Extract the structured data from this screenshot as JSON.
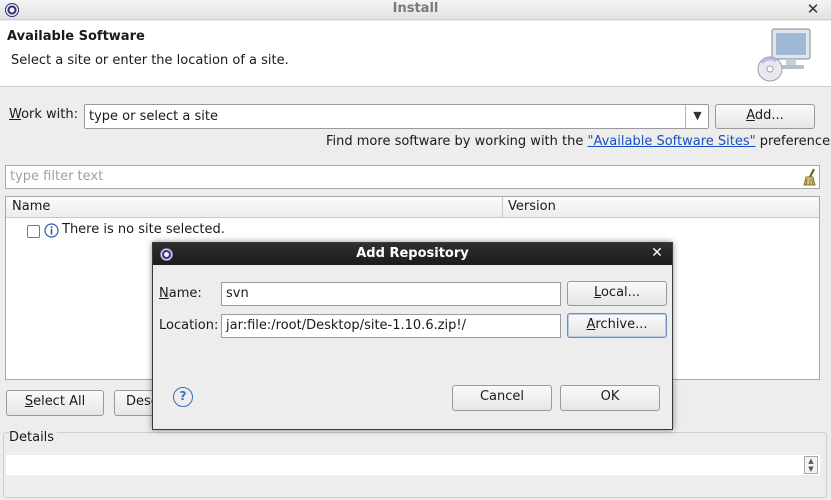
{
  "window": {
    "title": "Install"
  },
  "header": {
    "title": "Available Software",
    "subtitle": "Select a site or enter the location of a site."
  },
  "work_with": {
    "label_mnemonic": "W",
    "label_rest": "ork with:",
    "value": "type or select a site",
    "add_mnemonic": "A",
    "add_rest": "dd..."
  },
  "find_more": {
    "prefix": "Find more software by working with the ",
    "link": "\"Available Software Sites\"",
    "suffix": " preferences."
  },
  "filter": {
    "placeholder": "type filter text"
  },
  "table": {
    "columns": [
      "Name",
      "Version"
    ],
    "rows": [
      {
        "text": "There is no site selected."
      }
    ]
  },
  "buttons": {
    "select_all_mnemonic": "S",
    "select_all_rest": "elect All",
    "deselect_partial": "Dese"
  },
  "details": {
    "label": "Details"
  },
  "dialog": {
    "title": "Add Repository",
    "name_mnemonic": "N",
    "name_rest": "ame:",
    "name_value": "svn",
    "local_mnemonic": "L",
    "local_rest": "ocal...",
    "location_label": "Location:",
    "location_value": "jar:file:/root/Desktop/site-1.10.6.zip!/",
    "archive_mnemonic": "A",
    "archive_rest": "rchive...",
    "cancel": "Cancel",
    "ok": "OK",
    "help_glyph": "?"
  }
}
